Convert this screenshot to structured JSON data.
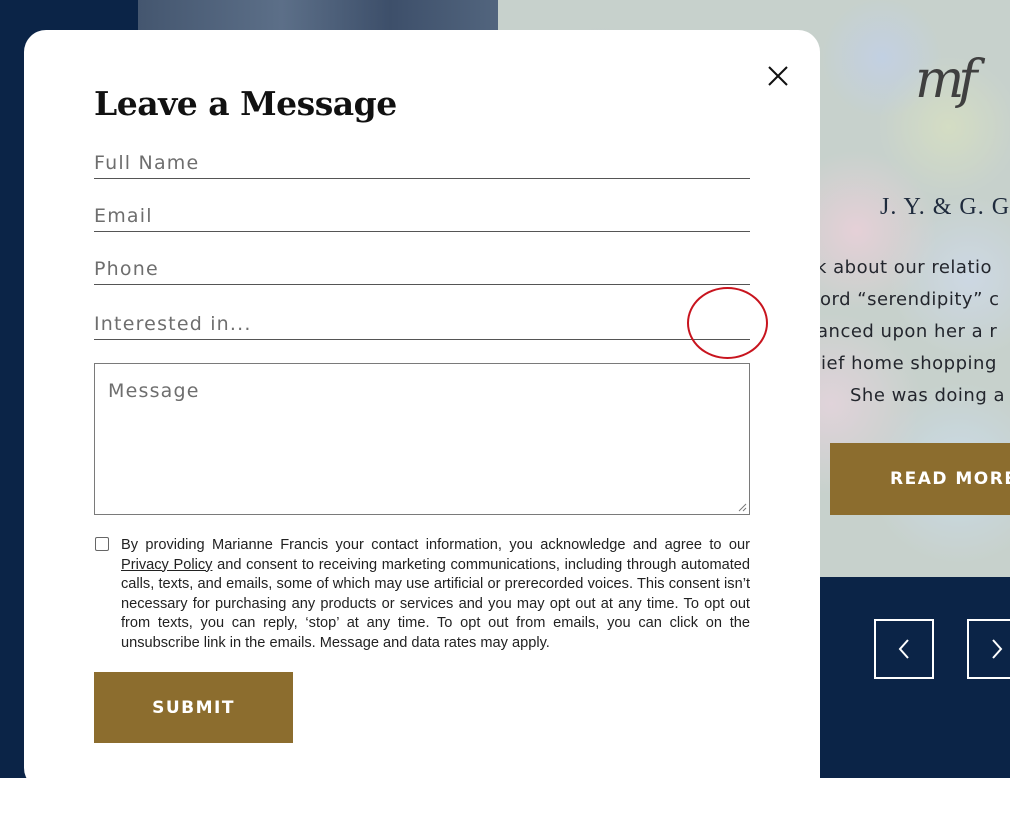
{
  "background": {
    "brand_logo_text": "mf",
    "review_author": "J. Y. & G. G",
    "review_lines": [
      "k about our relatio",
      "ord “serendipity” c",
      "anced upon her a r",
      "ief home shopping",
      "She was doing a"
    ],
    "read_more_label": "READ MORE",
    "prev_icon": "chevron-left-icon",
    "next_icon": "chevron-right-icon"
  },
  "modal": {
    "title": "Leave a Message",
    "close_icon": "close-icon",
    "fields": {
      "full_name_placeholder": "Full Name",
      "email_placeholder": "Email",
      "phone_placeholder": "Phone",
      "interest_placeholder": "Interested in...",
      "message_placeholder": "Message"
    },
    "consent": {
      "text_before_link": "By providing Marianne Francis your contact information, you acknowledge and agree to our ",
      "link_text": "Privacy Policy",
      "text_after_link": " and consent to receiving marketing communications, including through automated calls, texts, and emails, some of which may use artificial or prerecorded voices. This consent isn’t necessary for purchasing any products or services and you may opt out at any time. To opt out from texts, you can reply, ‘stop’ at any time. To opt out from emails, you can click on the unsubscribe link in the emails. Message and data rates may apply.",
      "checked": false
    },
    "submit_label": "SUBMIT"
  },
  "colors": {
    "navy": "#0b2447",
    "gold": "#8c6d2e",
    "annotation_red": "#c8141e"
  }
}
